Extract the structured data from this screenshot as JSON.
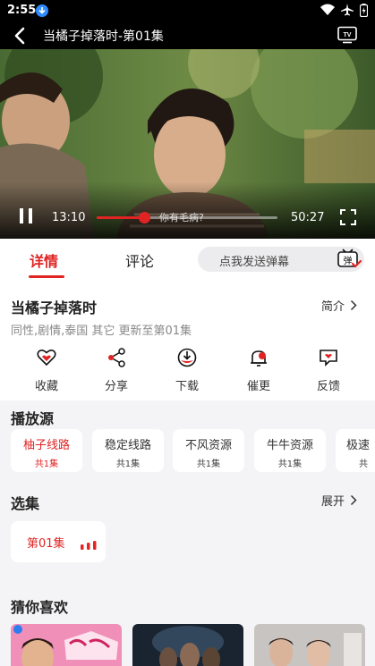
{
  "status": {
    "time": "2:55"
  },
  "header": {
    "title": "当橘子掉落时-第01集"
  },
  "player": {
    "current_time": "13:10",
    "duration": "50:27",
    "progress": 0.261,
    "subtitle": "你有毛病?"
  },
  "tabs": [
    {
      "label": "详情"
    },
    {
      "label": "评论"
    }
  ],
  "danmaku": {
    "placeholder": "点我发送弹幕",
    "icon_label": "弹"
  },
  "detail": {
    "title": "当橘子掉落时",
    "intro_label": "简介",
    "meta": "同性,剧情,泰国 其它 更新至第01集"
  },
  "actions": [
    {
      "label": "收藏",
      "icon": "heart-icon"
    },
    {
      "label": "分享",
      "icon": "share-icon"
    },
    {
      "label": "下载",
      "icon": "download-icon"
    },
    {
      "label": "催更",
      "icon": "bell-icon"
    },
    {
      "label": "反馈",
      "icon": "feedback-icon"
    }
  ],
  "sources": {
    "title": "播放源",
    "items": [
      {
        "name": "柚子线路",
        "count": "共1集",
        "active": true
      },
      {
        "name": "稳定线路",
        "count": "共1集",
        "active": false
      },
      {
        "name": "不风资源",
        "count": "共1集",
        "active": false
      },
      {
        "name": "牛牛资源",
        "count": "共1集",
        "active": false
      },
      {
        "name": "极速",
        "count": "共",
        "active": false
      }
    ]
  },
  "episodes": {
    "title": "选集",
    "expand_label": "展开",
    "items": [
      {
        "label": "第01集",
        "playing": true
      }
    ]
  },
  "recommend": {
    "title": "猜你喜欢"
  },
  "colors": {
    "accent": "#e02424",
    "page_bg": "#f4f4f6"
  }
}
